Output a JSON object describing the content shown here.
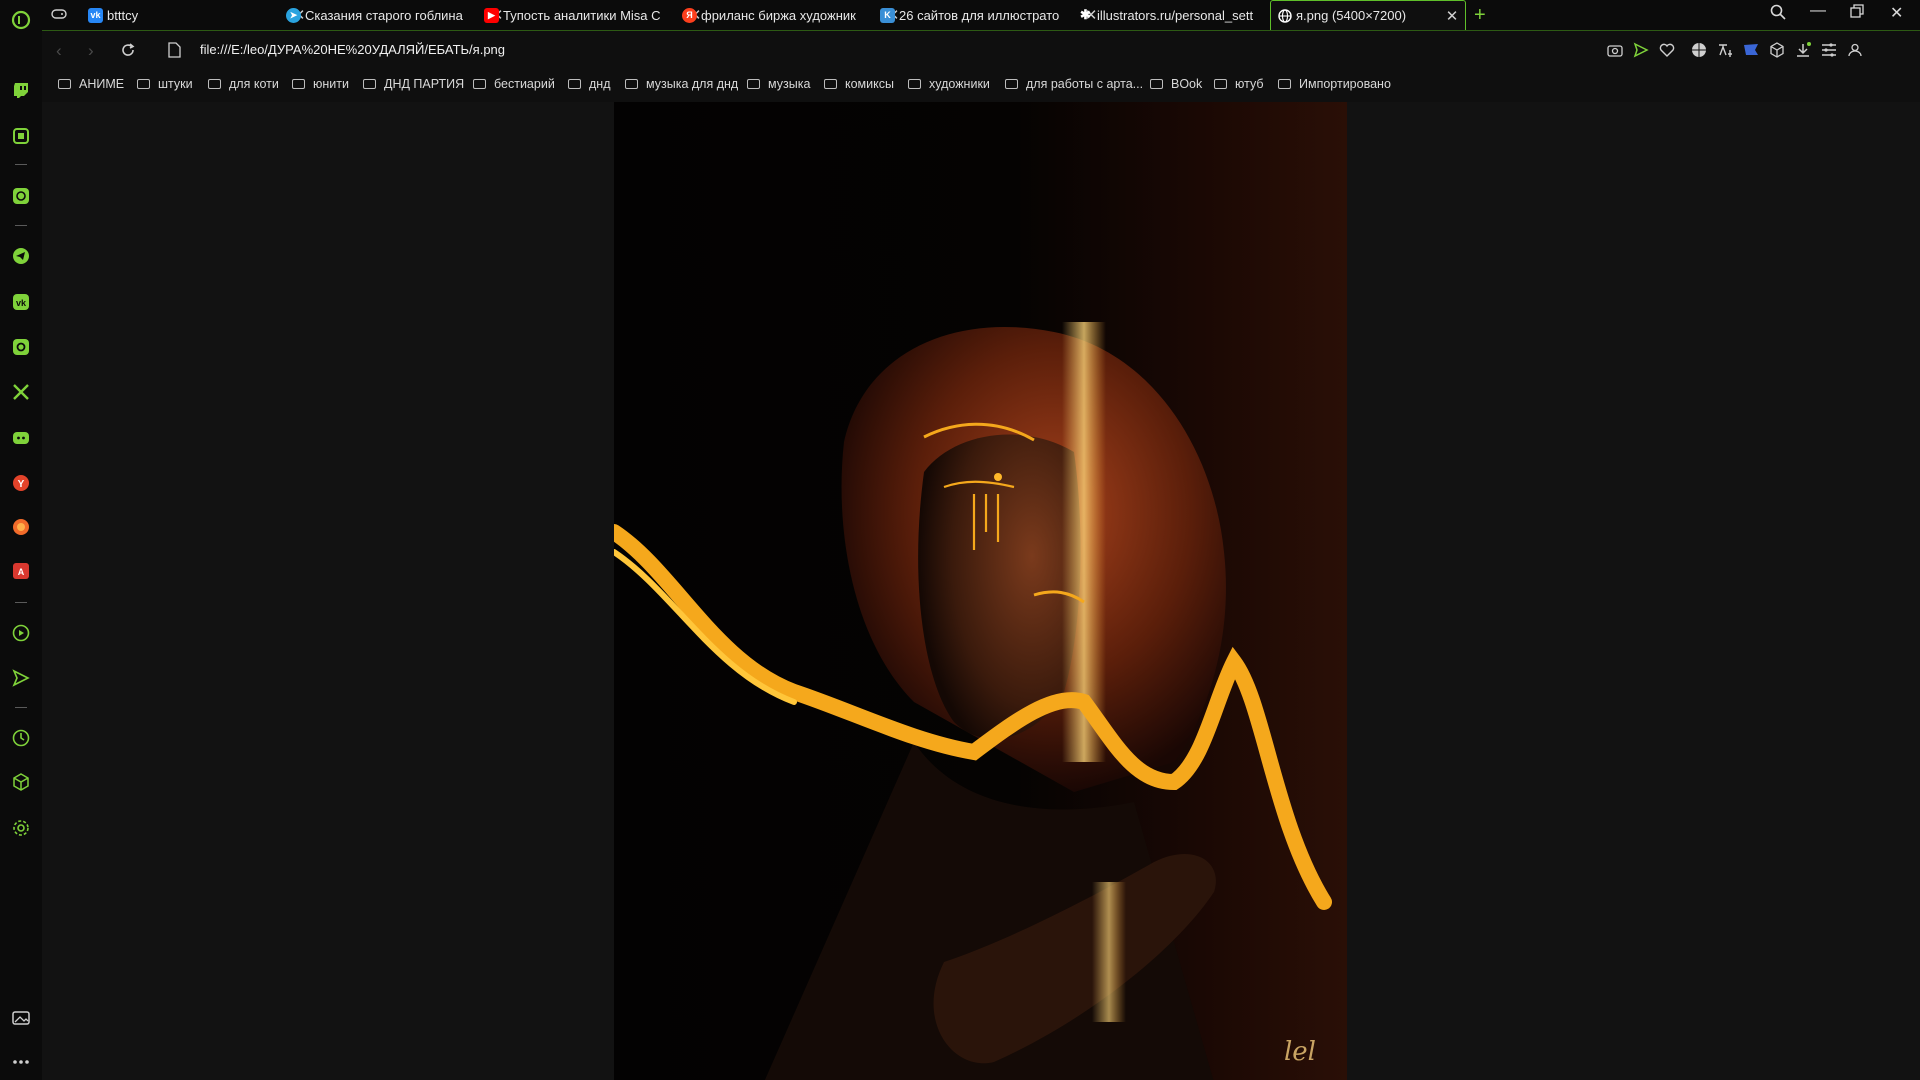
{
  "browser": {
    "tabs": [
      {
        "title": "btttcy",
        "icon": "vk-icon",
        "color": "#2787f5"
      },
      {
        "title": "Сказания старого гоблина",
        "icon": "telegram-icon",
        "color": "#2aa3df"
      },
      {
        "title": "Тупость аналитики Misa С",
        "icon": "youtube-icon",
        "color": "#ff0000"
      },
      {
        "title": "фриланс биржа художник",
        "icon": "yandex-icon",
        "color": "#fc3f1d"
      },
      {
        "title": "26 сайтов для иллюстрато",
        "icon": "site-k-icon",
        "color": "#3a8fd6"
      },
      {
        "title": "illustrators.ru/personal_sett",
        "icon": "bug-icon",
        "color": "#ffffff"
      },
      {
        "title": "я.png (5400×7200)",
        "icon": "globe-icon",
        "color": "#ffffff",
        "active": true
      }
    ],
    "address": "file:///E:/leo/ДУРА%20НЕ%20УДАЛЯЙ/ЕБАТЬ/я.png",
    "bookmarks": [
      "АНИМЕ",
      "штуки",
      "для коти",
      "юнити",
      "ДНД ПАРТИЯ",
      "бестиарий",
      "днд",
      "музыка для днд",
      "музыка",
      "комиксы",
      "художники",
      "для работы с арта...",
      "BOok",
      "ютуб",
      "Импортировано"
    ],
    "accent_color": "#7fd23a",
    "artwork_signature": "lel"
  },
  "sidebar": {
    "items": [
      "twitch-icon",
      "opera-box-icon",
      "chatgpt-icon",
      "telegram-icon",
      "vk-icon",
      "instagram-icon",
      "x-icon",
      "discord-icon",
      "yandex-icon",
      "vkplay-icon",
      "aria-icon",
      "player-icon",
      "send-icon",
      "history-icon",
      "cube-icon",
      "settings-icon",
      "gallery-icon",
      "more-icon"
    ]
  }
}
